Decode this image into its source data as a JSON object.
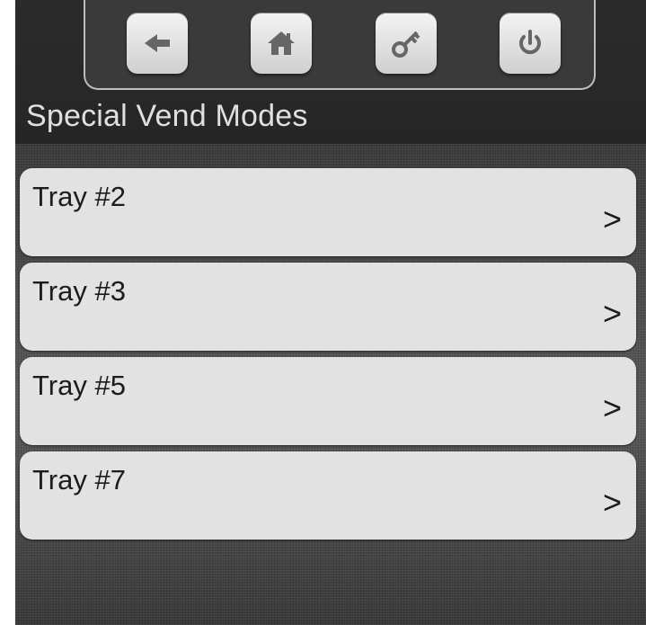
{
  "header": {
    "title": "Special Vend Modes",
    "toolbar": [
      {
        "name": "back-button",
        "icon": "arrow-left-icon"
      },
      {
        "name": "home-button",
        "icon": "home-icon"
      },
      {
        "name": "key-button",
        "icon": "key-icon"
      },
      {
        "name": "power-button",
        "icon": "power-icon"
      }
    ]
  },
  "trays": [
    {
      "label": "Tray #2",
      "chevron": ">"
    },
    {
      "label": "Tray #3",
      "chevron": ">"
    },
    {
      "label": "Tray #5",
      "chevron": ">"
    },
    {
      "label": "Tray #7",
      "chevron": ">"
    }
  ],
  "colors": {
    "background": "#2a2a2a",
    "row": "#e2e2e2",
    "title_text": "#e0e0e0",
    "icon": "#666666"
  }
}
